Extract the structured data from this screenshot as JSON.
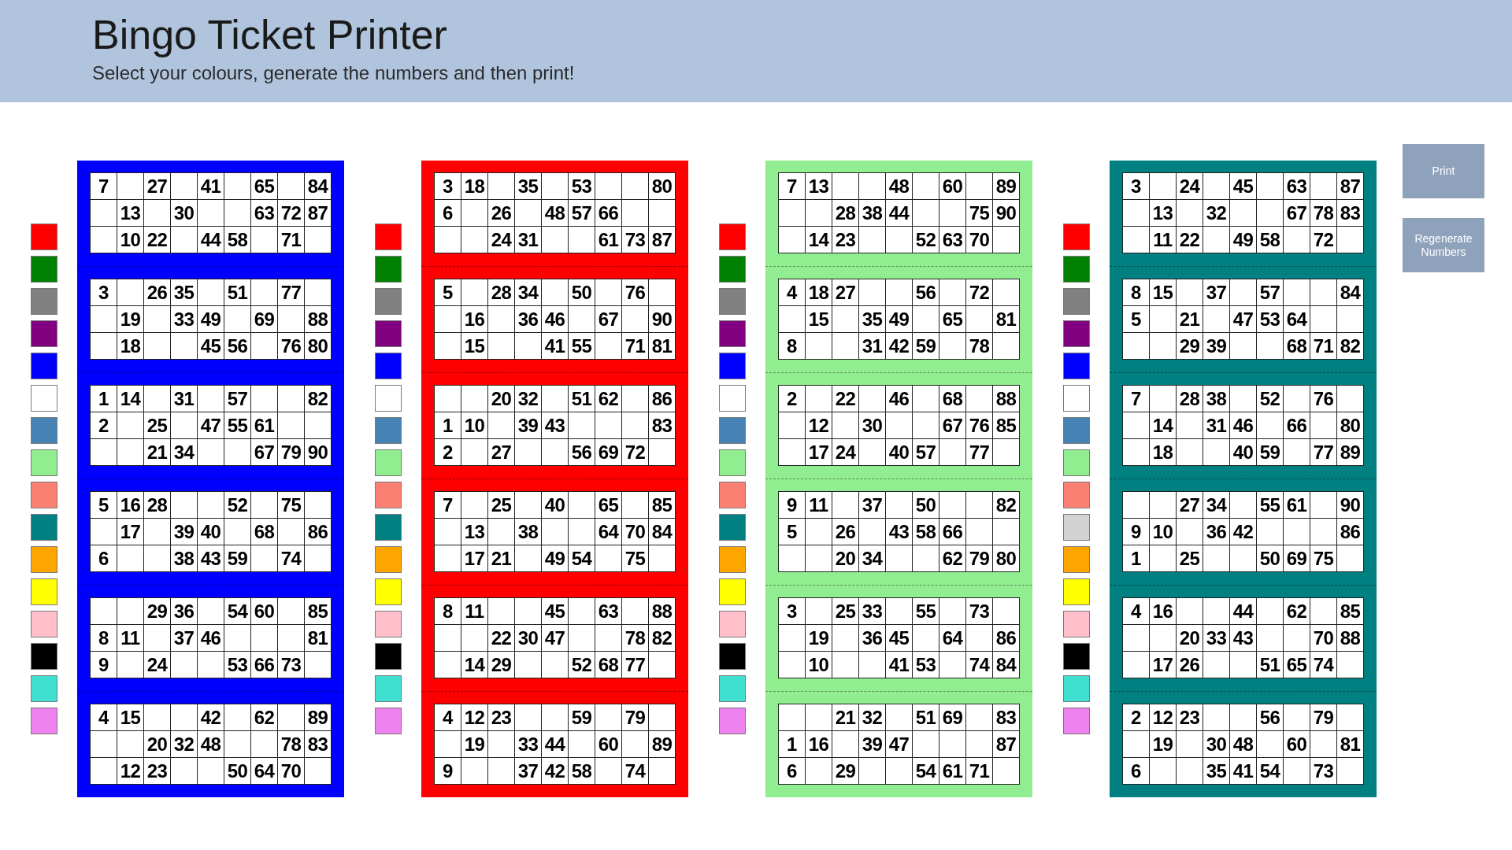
{
  "header": {
    "title": "Bingo Ticket Printer",
    "subtitle": "Select your colours, generate the numbers and then print!"
  },
  "books": [
    {
      "color": "#0000ff",
      "swatches": [
        {
          "color": "#ff0000"
        },
        {
          "color": "#008000"
        },
        {
          "color": "#808080"
        },
        {
          "color": "#800080"
        },
        {
          "color": "#0000ff"
        },
        {
          "color": "#ffffff"
        },
        {
          "color": "#4682b4"
        },
        {
          "color": "#90ee90"
        },
        {
          "color": "#fa8072"
        },
        {
          "color": "#008080"
        },
        {
          "color": "#ffa500"
        },
        {
          "color": "#ffff00"
        },
        {
          "color": "#ffc0cb"
        },
        {
          "color": "#000000"
        },
        {
          "color": "#40e0d0"
        },
        {
          "color": "#ee82ee"
        }
      ],
      "tickets": [
        [
          [
            "7",
            "27",
            "41",
            "65",
            "84"
          ],
          [
            "13",
            "30",
            "63",
            "72",
            "87"
          ],
          [
            "10",
            "22",
            "44",
            "58",
            "71"
          ]
        ],
        [
          [
            "3",
            "26",
            "35",
            "51",
            "77"
          ],
          [
            "19",
            "33",
            "49",
            "69",
            "88"
          ],
          [
            "18",
            "45",
            "56",
            "76",
            "80"
          ]
        ],
        [
          [
            "1",
            "14",
            "31",
            "57",
            "82"
          ],
          [
            "2",
            "25",
            "47",
            "55",
            "61"
          ],
          [
            "21",
            "34",
            "67",
            "79",
            "90"
          ]
        ],
        [
          [
            "5",
            "16",
            "28",
            "52",
            "75"
          ],
          [
            "17",
            "39",
            "40",
            "68",
            "86"
          ],
          [
            "6",
            "38",
            "43",
            "59",
            "74"
          ]
        ],
        [
          [
            "29",
            "36",
            "54",
            "60",
            "85"
          ],
          [
            "8",
            "11",
            "37",
            "46",
            "81"
          ],
          [
            "9",
            "24",
            "53",
            "66",
            "73"
          ]
        ],
        [
          [
            "4",
            "15",
            "42",
            "62",
            "89"
          ],
          [
            "20",
            "32",
            "48",
            "78",
            "83"
          ],
          [
            "12",
            "23",
            "50",
            "64",
            "70"
          ]
        ]
      ]
    },
    {
      "color": "#ff0000",
      "swatches": [
        {
          "color": "#ff0000"
        },
        {
          "color": "#008000"
        },
        {
          "color": "#808080"
        },
        {
          "color": "#800080"
        },
        {
          "color": "#0000ff"
        },
        {
          "color": "#ffffff"
        },
        {
          "color": "#4682b4"
        },
        {
          "color": "#90ee90"
        },
        {
          "color": "#fa8072"
        },
        {
          "color": "#008080"
        },
        {
          "color": "#ffa500"
        },
        {
          "color": "#ffff00"
        },
        {
          "color": "#ffc0cb"
        },
        {
          "color": "#000000"
        },
        {
          "color": "#40e0d0"
        },
        {
          "color": "#ee82ee"
        }
      ],
      "tickets": [
        [
          [
            "3",
            "18",
            "35",
            "53",
            "80"
          ],
          [
            "6",
            "26",
            "48",
            "57",
            "66"
          ],
          [
            "24",
            "31",
            "61",
            "73",
            "87"
          ]
        ],
        [
          [
            "5",
            "28",
            "34",
            "50",
            "76"
          ],
          [
            "16",
            "36",
            "46",
            "67",
            "90"
          ],
          [
            "15",
            "41",
            "55",
            "71",
            "81"
          ]
        ],
        [
          [
            "20",
            "32",
            "51",
            "62",
            "86"
          ],
          [
            "1",
            "10",
            "39",
            "43",
            "83"
          ],
          [
            "2",
            "27",
            "56",
            "69",
            "72"
          ]
        ],
        [
          [
            "7",
            "25",
            "40",
            "65",
            "85"
          ],
          [
            "13",
            "38",
            "64",
            "70",
            "84"
          ],
          [
            "17",
            "21",
            "49",
            "54",
            "75"
          ]
        ],
        [
          [
            "8",
            "11",
            "45",
            "63",
            "88"
          ],
          [
            "22",
            "30",
            "47",
            "78",
            "82"
          ],
          [
            "14",
            "29",
            "52",
            "68",
            "77"
          ]
        ],
        [
          [
            "4",
            "12",
            "23",
            "59",
            "79"
          ],
          [
            "19",
            "33",
            "44",
            "60",
            "89"
          ],
          [
            "9",
            "37",
            "42",
            "58",
            "74"
          ]
        ]
      ]
    },
    {
      "color": "#90ee90",
      "swatches": [
        {
          "color": "#ff0000"
        },
        {
          "color": "#008000"
        },
        {
          "color": "#808080"
        },
        {
          "color": "#800080"
        },
        {
          "color": "#0000ff"
        },
        {
          "color": "#ffffff"
        },
        {
          "color": "#4682b4"
        },
        {
          "color": "#90ee90"
        },
        {
          "color": "#fa8072"
        },
        {
          "color": "#008080"
        },
        {
          "color": "#ffa500"
        },
        {
          "color": "#ffff00"
        },
        {
          "color": "#ffc0cb"
        },
        {
          "color": "#000000"
        },
        {
          "color": "#40e0d0"
        },
        {
          "color": "#ee82ee"
        }
      ],
      "tickets": [
        [
          [
            "7",
            "13",
            "48",
            "60",
            "89"
          ],
          [
            "28",
            "38",
            "44",
            "75",
            "90"
          ],
          [
            "14",
            "23",
            "52",
            "63",
            "70"
          ]
        ],
        [
          [
            "4",
            "18",
            "27",
            "56",
            "72"
          ],
          [
            "15",
            "35",
            "49",
            "65",
            "81"
          ],
          [
            "8",
            "31",
            "42",
            "59",
            "78"
          ]
        ],
        [
          [
            "2",
            "22",
            "46",
            "68",
            "88"
          ],
          [
            "12",
            "30",
            "67",
            "76",
            "85"
          ],
          [
            "17",
            "24",
            "40",
            "57",
            "77"
          ]
        ],
        [
          [
            "9",
            "11",
            "37",
            "50",
            "82"
          ],
          [
            "5",
            "26",
            "43",
            "58",
            "66"
          ],
          [
            "20",
            "34",
            "62",
            "79",
            "80"
          ]
        ],
        [
          [
            "3",
            "25",
            "33",
            "55",
            "73"
          ],
          [
            "19",
            "36",
            "45",
            "64",
            "86"
          ],
          [
            "10",
            "41",
            "53",
            "74",
            "84"
          ]
        ],
        [
          [
            "21",
            "32",
            "51",
            "69",
            "83"
          ],
          [
            "1",
            "16",
            "39",
            "47",
            "87"
          ],
          [
            "6",
            "29",
            "54",
            "61",
            "71"
          ]
        ]
      ]
    },
    {
      "color": "#008080",
      "swatches": [
        {
          "color": "#ff0000"
        },
        {
          "color": "#008000"
        },
        {
          "color": "#808080"
        },
        {
          "color": "#800080"
        },
        {
          "color": "#0000ff"
        },
        {
          "color": "#ffffff"
        },
        {
          "color": "#4682b4"
        },
        {
          "color": "#90ee90"
        },
        {
          "color": "#fa8072"
        },
        {
          "color": "#d3d3d3"
        },
        {
          "color": "#ffa500"
        },
        {
          "color": "#ffff00"
        },
        {
          "color": "#ffc0cb"
        },
        {
          "color": "#000000"
        },
        {
          "color": "#40e0d0"
        },
        {
          "color": "#ee82ee"
        }
      ],
      "tickets": [
        [
          [
            "3",
            "24",
            "45",
            "63",
            "87"
          ],
          [
            "13",
            "32",
            "67",
            "78",
            "83"
          ],
          [
            "11",
            "22",
            "49",
            "58",
            "72"
          ]
        ],
        [
          [
            "8",
            "15",
            "37",
            "57",
            "84"
          ],
          [
            "5",
            "21",
            "47",
            "53",
            "64"
          ],
          [
            "29",
            "39",
            "68",
            "71",
            "82"
          ]
        ],
        [
          [
            "7",
            "28",
            "38",
            "52",
            "76"
          ],
          [
            "14",
            "31",
            "46",
            "66",
            "80"
          ],
          [
            "18",
            "40",
            "59",
            "77",
            "89"
          ]
        ],
        [
          [
            "27",
            "34",
            "55",
            "61",
            "90"
          ],
          [
            "9",
            "10",
            "36",
            "42",
            "86"
          ],
          [
            "1",
            "25",
            "50",
            "69",
            "75"
          ]
        ],
        [
          [
            "4",
            "16",
            "44",
            "62",
            "85"
          ],
          [
            "20",
            "33",
            "43",
            "70",
            "88"
          ],
          [
            "17",
            "26",
            "51",
            "65",
            "74"
          ]
        ],
        [
          [
            "2",
            "12",
            "23",
            "56",
            "79"
          ],
          [
            "19",
            "30",
            "48",
            "60",
            "81"
          ],
          [
            "6",
            "35",
            "41",
            "54",
            "73"
          ]
        ]
      ]
    }
  ],
  "buttons": [
    "Print",
    "Regenerate Numbers"
  ]
}
